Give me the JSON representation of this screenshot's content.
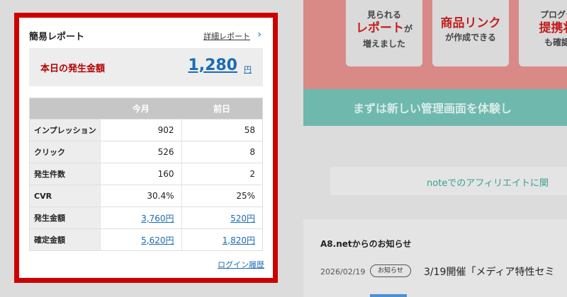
{
  "report": {
    "title": "簡易レポート",
    "detail_link": "詳細レポート",
    "detail_icon": "chevron-right-icon",
    "today_label": "本日の発生金額",
    "today_value": "1,280",
    "today_unit": "円",
    "columns": [
      "",
      "今月",
      "前日"
    ],
    "rows": [
      {
        "label": "インプレッション",
        "this_month": "902",
        "prev_day": "58",
        "link": false
      },
      {
        "label": "クリック",
        "this_month": "526",
        "prev_day": "8",
        "link": false
      },
      {
        "label": "発生件数",
        "this_month": "160",
        "prev_day": "2",
        "link": false
      },
      {
        "label": "CVR",
        "this_month": "30.4%",
        "prev_day": "25%",
        "link": false
      },
      {
        "label": "発生金額",
        "this_month": "3,760円",
        "prev_day": "520円",
        "link": true
      },
      {
        "label": "確定金額",
        "this_month": "5,620円",
        "prev_day": "1,820円",
        "link": true
      }
    ],
    "login_history": "ログイン履歴"
  },
  "banner": {
    "cards": [
      {
        "line1": "見られる",
        "big": "レポート",
        "line2": "が",
        "line3": "増えました"
      },
      {
        "line1": "",
        "big": "商品リンク",
        "line2": "が作成できる",
        "line3": ""
      },
      {
        "line1": "プログラ",
        "big": "提携状",
        "line2": "",
        "line3": "も確認"
      }
    ],
    "strip_text": "まずは新しい管理画面を体験し"
  },
  "note_text": "noteでのアフィリエイトに関",
  "news": {
    "title": "A8.netからのお知らせ",
    "date": "2026/02/19",
    "badge": "お知らせ",
    "text": "3/19開催「メディア特性セミ"
  },
  "colors": {
    "frame": "#cc0000",
    "accent_red": "#b30000",
    "link_blue": "#1a6bb3",
    "banner_pink": "#d98a87",
    "strip_teal": "#6fb8ad"
  }
}
